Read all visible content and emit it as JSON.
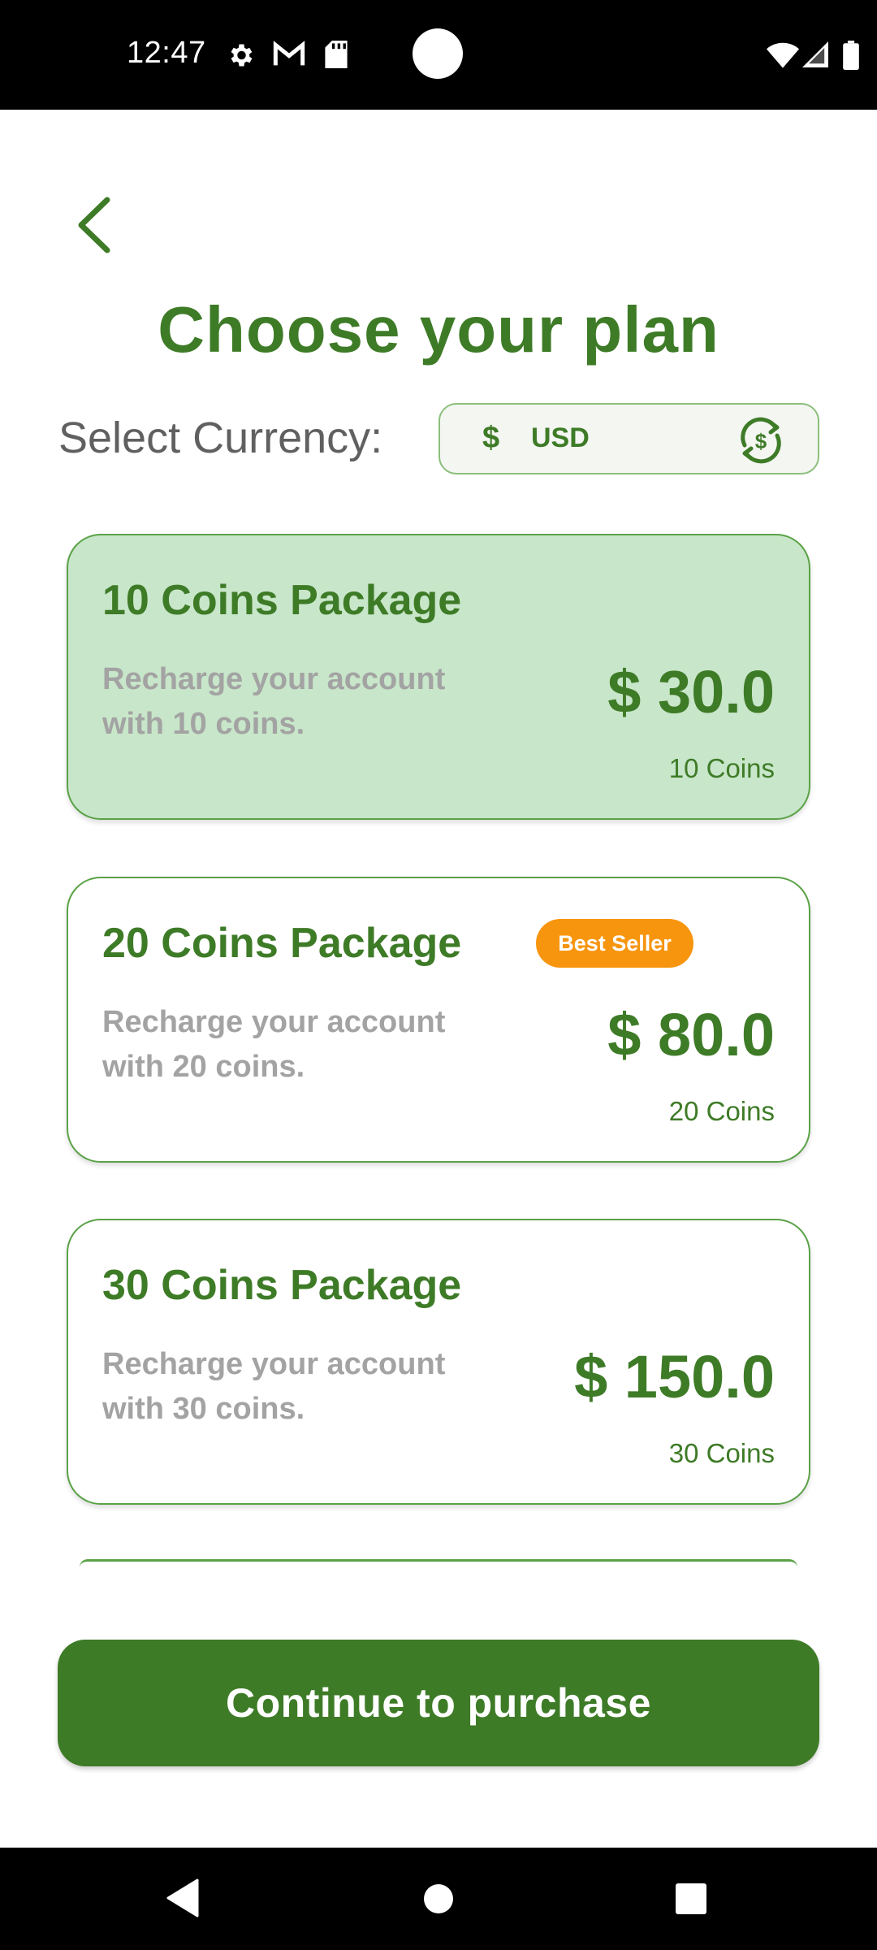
{
  "status_bar": {
    "time": "12:47"
  },
  "header": {
    "title": "Choose your plan"
  },
  "currency": {
    "label": "Select Currency:",
    "symbol": "$",
    "code": "USD"
  },
  "plans": [
    {
      "name": "10 Coins Package",
      "description": "Recharge your account with 10 coins.",
      "price": "$ 30.0",
      "coins": "10 Coins",
      "selected": true
    },
    {
      "name": "20 Coins Package",
      "badge": "Best Seller",
      "description": "Recharge your account with 20 coins.",
      "price": "$ 80.0",
      "coins": "20 Coins",
      "selected": false
    },
    {
      "name": "30 Coins Package",
      "description": "Recharge your account with 30 coins.",
      "price": "$ 150.0",
      "coins": "30 Coins",
      "selected": false
    }
  ],
  "actions": {
    "continue_label": "Continue to purchase"
  },
  "icons": {
    "back": "chevron-left-icon",
    "currency_swap": "currency-exchange-icon",
    "status": [
      "settings-icon",
      "gmail-icon",
      "sd-card-icon",
      "wifi-icon",
      "signal-icon",
      "battery-icon"
    ],
    "nav": [
      "back-triangle-icon",
      "home-circle-icon",
      "recents-square-icon"
    ]
  },
  "colors": {
    "primary": "#3e7b27",
    "selected_card": "#c8e6c9",
    "badge": "#f7950f",
    "muted_text": "#a3a3a3"
  }
}
